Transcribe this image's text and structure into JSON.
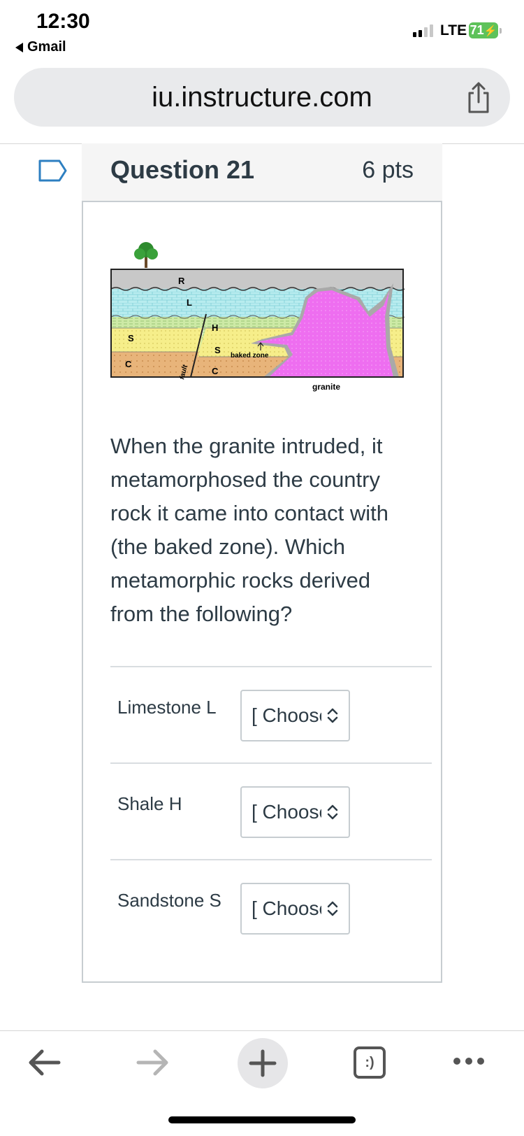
{
  "status_bar": {
    "time": "12:30",
    "back_app": "Gmail",
    "network": "LTE",
    "battery": "71"
  },
  "browser": {
    "url": "iu.instructure.com",
    "share_icon": "share-icon"
  },
  "question": {
    "title": "Question 21",
    "points": "6 pts",
    "text": "When the granite intruded, it metamorphosed the country rock it came into contact with (the baked zone).  Which metamorphic rocks derived from the following?",
    "diagram_labels": {
      "R": "R",
      "L": "L",
      "H": "H",
      "S_left": "S",
      "S_mid": "S",
      "C_left": "C",
      "C_mid": "C",
      "fault": "fault",
      "baked_zone": "baked zone",
      "granite": "granite"
    },
    "matches": [
      {
        "label": "Limestone L",
        "selected": "[ Choose ]"
      },
      {
        "label": "Shale H",
        "selected": "[ Choose ]"
      },
      {
        "label": "Sandstone S",
        "selected": "[ Choose ]"
      }
    ]
  },
  "toolbar": {
    "back_icon": "back-arrow-icon",
    "forward_icon": "forward-arrow-icon",
    "new_tab_icon": "plus-icon",
    "tabs_label": ":)",
    "more_icon": "more-icon"
  },
  "colors": {
    "text": "#2d3b45",
    "border": "#c7cdd1",
    "granite": "#ee6ef0",
    "limestone": "#b8ecef",
    "shale": "#cdeaa6",
    "sandstone": "#f6ee8a",
    "conglomerate": "#e8b47a"
  }
}
